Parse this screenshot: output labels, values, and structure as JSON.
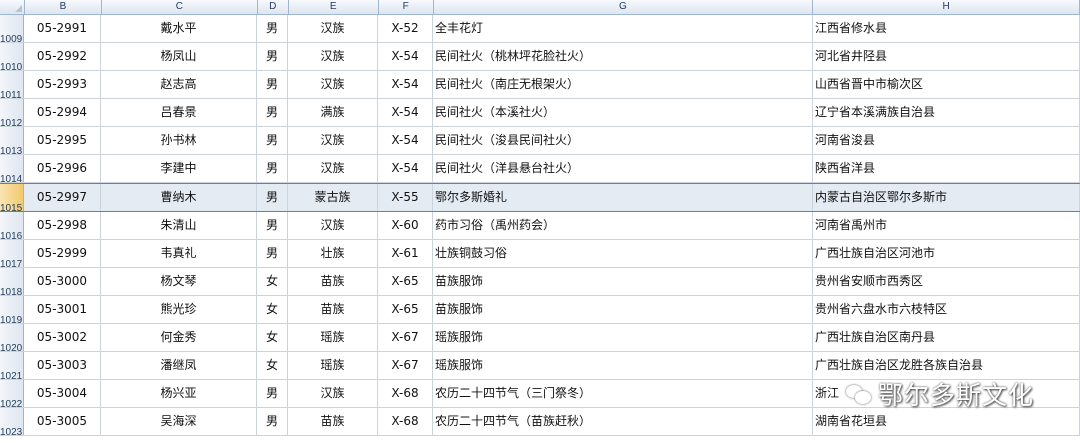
{
  "column_headers": [
    "B",
    "C",
    "D",
    "E",
    "F",
    "G",
    "H"
  ],
  "rows": [
    {
      "num": "1009",
      "code": "05-2991",
      "name": "戴水平",
      "gender": "男",
      "ethnic": "汉族",
      "category": "X-52",
      "project": "全丰花灯",
      "region": "江西省修水县"
    },
    {
      "num": "1010",
      "code": "05-2992",
      "name": "杨凤山",
      "gender": "男",
      "ethnic": "汉族",
      "category": "X-54",
      "project": "民间社火（桃林坪花脸社火）",
      "region": "河北省井陉县"
    },
    {
      "num": "1011",
      "code": "05-2993",
      "name": "赵志高",
      "gender": "男",
      "ethnic": "汉族",
      "category": "X-54",
      "project": "民间社火（南庄无根架火）",
      "region": "山西省晋中市榆次区"
    },
    {
      "num": "1012",
      "code": "05-2994",
      "name": "吕春景",
      "gender": "男",
      "ethnic": "满族",
      "category": "X-54",
      "project": "民间社火（本溪社火）",
      "region": "辽宁省本溪满族自治县"
    },
    {
      "num": "1013",
      "code": "05-2995",
      "name": "孙书林",
      "gender": "男",
      "ethnic": "汉族",
      "category": "X-54",
      "project": "民间社火（浚县民间社火）",
      "region": "河南省浚县"
    },
    {
      "num": "1014",
      "code": "05-2996",
      "name": "李建中",
      "gender": "男",
      "ethnic": "汉族",
      "category": "X-54",
      "project": "民间社火（洋县悬台社火）",
      "region": "陕西省洋县"
    },
    {
      "num": "1015",
      "code": "05-2997",
      "name": "曹纳木",
      "gender": "男",
      "ethnic": "蒙古族",
      "category": "X-55",
      "project": "鄂尔多斯婚礼",
      "region": "内蒙古自治区鄂尔多斯市"
    },
    {
      "num": "1016",
      "code": "05-2998",
      "name": "朱清山",
      "gender": "男",
      "ethnic": "汉族",
      "category": "X-60",
      "project": "药市习俗（禹州药会）",
      "region": "河南省禹州市"
    },
    {
      "num": "1017",
      "code": "05-2999",
      "name": "韦真礼",
      "gender": "男",
      "ethnic": "壮族",
      "category": "X-61",
      "project": "壮族铜鼓习俗",
      "region": "广西壮族自治区河池市"
    },
    {
      "num": "1018",
      "code": "05-3000",
      "name": "杨文琴",
      "gender": "女",
      "ethnic": "苗族",
      "category": "X-65",
      "project": "苗族服饰",
      "region": "贵州省安顺市西秀区"
    },
    {
      "num": "1019",
      "code": "05-3001",
      "name": "熊光珍",
      "gender": "女",
      "ethnic": "苗族",
      "category": "X-65",
      "project": "苗族服饰",
      "region": "贵州省六盘水市六枝特区"
    },
    {
      "num": "1020",
      "code": "05-3002",
      "name": "何金秀",
      "gender": "女",
      "ethnic": "瑶族",
      "category": "X-67",
      "project": "瑶族服饰",
      "region": "广西壮族自治区南丹县"
    },
    {
      "num": "1021",
      "code": "05-3003",
      "name": "潘继凤",
      "gender": "女",
      "ethnic": "瑶族",
      "category": "X-67",
      "project": "瑶族服饰",
      "region": "广西壮族自治区龙胜各族自治县"
    },
    {
      "num": "1022",
      "code": "05-3004",
      "name": "杨兴亚",
      "gender": "男",
      "ethnic": "汉族",
      "category": "X-68",
      "project": "农历二十四节气（三门祭冬）",
      "region": "浙江"
    },
    {
      "num": "1023",
      "code": "05-3005",
      "name": "吴海深",
      "gender": "男",
      "ethnic": "苗族",
      "category": "X-68",
      "project": "农历二十四节气（苗族赶秋）",
      "region": "湖南省花垣县"
    }
  ],
  "selected_row": "1015",
  "watermark_text": "鄂尔多斯文化"
}
